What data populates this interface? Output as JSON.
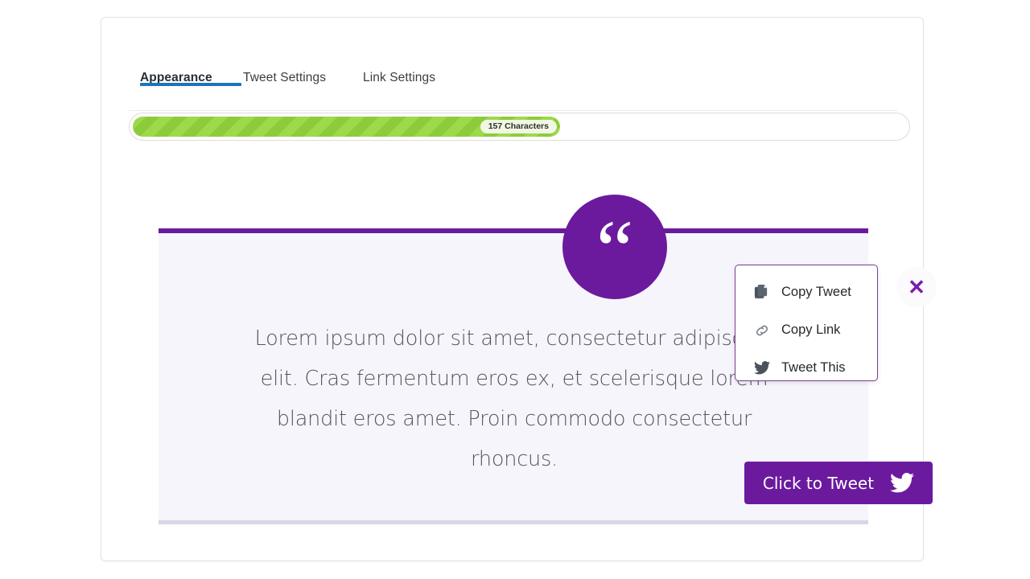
{
  "tabs": [
    {
      "label": "Appearance",
      "active": true
    },
    {
      "label": "Tweet Settings",
      "active": false
    },
    {
      "label": "Link Settings",
      "active": false
    }
  ],
  "progress": {
    "badge_label": "157 Characters",
    "characters": 157,
    "fill_percent": 55,
    "fill_color": "#8ccc3a",
    "stripe_color": "#9ed84b"
  },
  "quote": {
    "mark": "“",
    "text": "Lorem ipsum dolor sit amet, consectetur adipiscing elit. Cras fermentum eros ex, et scelerisque lorem blandit eros amet. Proin commodo consectetur rhoncus.",
    "accent_color": "#6b1a9e",
    "background_color": "#f6f5fb",
    "bottom_border_color": "#d8d5e8"
  },
  "tweet_button": {
    "label": "Click to Tweet",
    "icon": "twitter-bird-icon",
    "color": "#6b1a9e"
  },
  "close_button": {
    "label": "✕",
    "icon": "close-icon",
    "color": "#7a1ca8"
  },
  "menu": {
    "items": [
      {
        "label": "Copy Tweet",
        "icon": "copy-icon"
      },
      {
        "label": "Copy Link",
        "icon": "link-icon"
      },
      {
        "label": "Tweet This",
        "icon": "twitter-bird-icon"
      }
    ],
    "border_color": "#7a3d94"
  },
  "theme": {
    "tab_active_underline": "#1b75bb",
    "card_border": "#e2e2e2"
  }
}
